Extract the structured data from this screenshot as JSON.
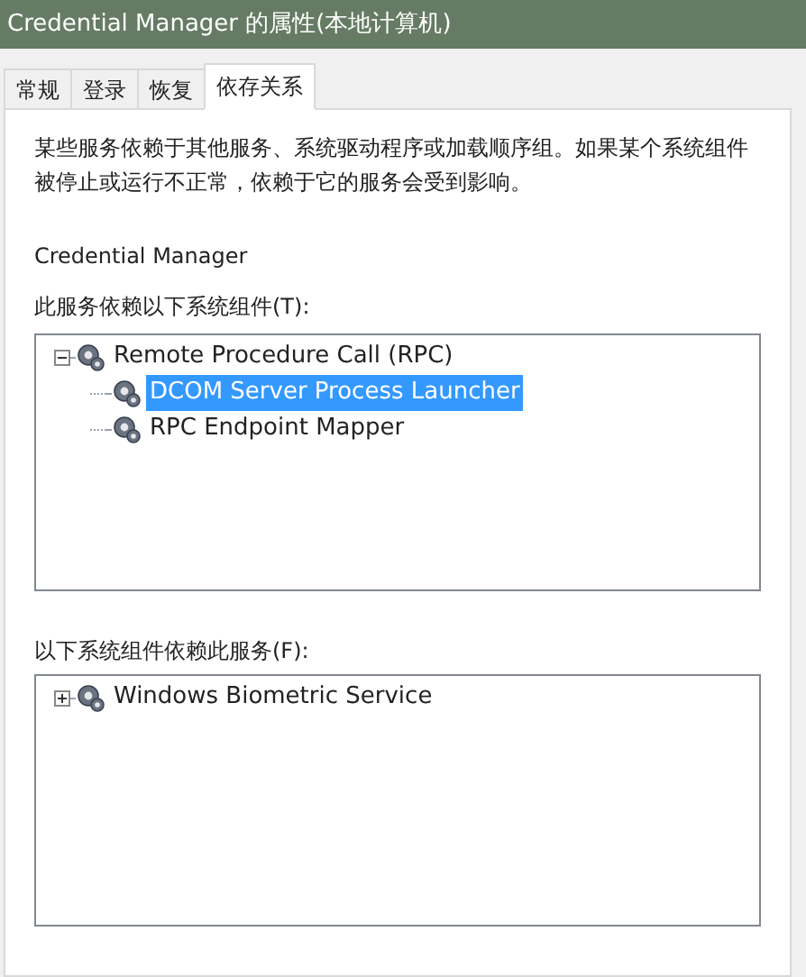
{
  "window": {
    "title": "Credential Manager 的属性(本地计算机)"
  },
  "tabs": [
    {
      "label": "常规",
      "selected": false
    },
    {
      "label": "登录",
      "selected": false
    },
    {
      "label": "恢复",
      "selected": false
    },
    {
      "label": "依存关系",
      "selected": true
    }
  ],
  "description": "某些服务依赖于其他服务、系统驱动程序或加载顺序组。如果某个系统组件被停止或运行不正常，依赖于它的服务会受到影响。",
  "service_name": "Credential Manager",
  "depends_on": {
    "label": "此服务依赖以下系统组件(T):",
    "items": [
      {
        "label": "Remote Procedure Call (RPC)",
        "selected": false,
        "expanded": true,
        "children": [
          {
            "label": "DCOM Server Process Launcher",
            "selected": true
          },
          {
            "label": "RPC Endpoint Mapper",
            "selected": false
          }
        ]
      }
    ]
  },
  "dependents": {
    "label": "以下系统组件依赖此服务(F):",
    "items": [
      {
        "label": "Windows Biometric Service",
        "selected": false,
        "expanded": false
      }
    ]
  }
}
